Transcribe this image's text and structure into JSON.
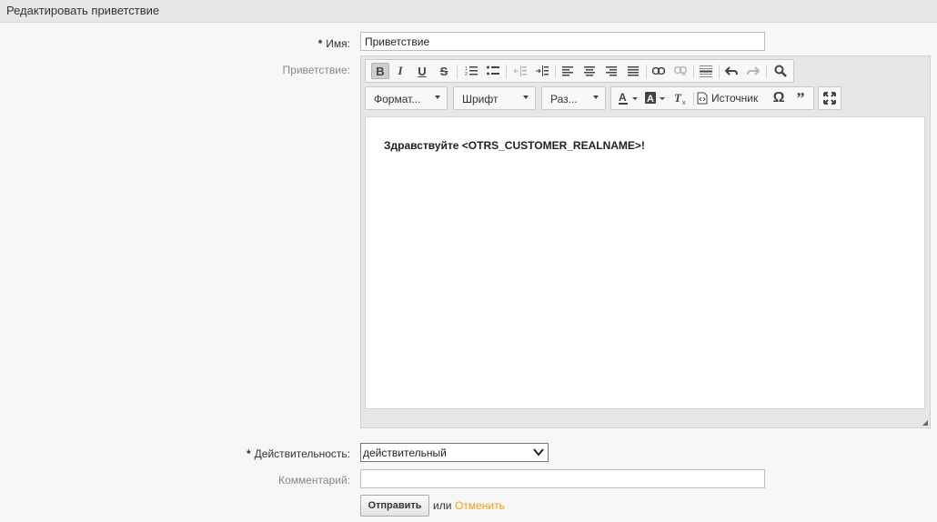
{
  "header": {
    "title": "Редактировать приветствие"
  },
  "form": {
    "name_label": "Имя:",
    "name_value": "Приветствие",
    "greeting_label": "Приветствие:",
    "validity_label": "Действительность:",
    "validity_value": "действительный",
    "comment_label": "Комментарий:",
    "comment_value": "",
    "submit_label": "Отправить",
    "or_text": "или",
    "cancel_label": "Отменить",
    "required_mark": "*"
  },
  "editor": {
    "toolbar_row1": [
      {
        "name": "bold-icon",
        "glyph": "B",
        "active": true
      },
      {
        "name": "italic-icon",
        "glyph": "I"
      },
      {
        "name": "underline-icon",
        "glyph": "U"
      },
      {
        "name": "strikethrough-icon",
        "glyph": "S"
      },
      {
        "name": "numbered-list-icon",
        "glyph": "≔"
      },
      {
        "name": "bulleted-list-icon",
        "glyph": "☰"
      },
      {
        "name": "outdent-icon",
        "glyph": "⇤",
        "dim": true
      },
      {
        "name": "indent-icon",
        "glyph": "⇥"
      },
      {
        "name": "align-left-icon",
        "glyph": "≡"
      },
      {
        "name": "align-center-icon",
        "glyph": "≡"
      },
      {
        "name": "align-right-icon",
        "glyph": "≡"
      },
      {
        "name": "align-justify-icon",
        "glyph": "≡"
      },
      {
        "name": "link-icon",
        "glyph": "⚭"
      },
      {
        "name": "unlink-icon",
        "glyph": "⚭",
        "dim": true
      },
      {
        "name": "horizontal-rule-icon",
        "glyph": "☰"
      },
      {
        "name": "undo-icon",
        "glyph": "↶"
      },
      {
        "name": "redo-icon",
        "glyph": "↷",
        "dim": true
      },
      {
        "name": "find-icon",
        "glyph": "🔍"
      }
    ],
    "format_combo": "Формат...",
    "font_combo": "Шрифт",
    "size_combo": "Раз...",
    "source_label": "Источник",
    "content_text": "Здравствуйте <OTRS_CUSTOMER_REALNAME>!"
  }
}
